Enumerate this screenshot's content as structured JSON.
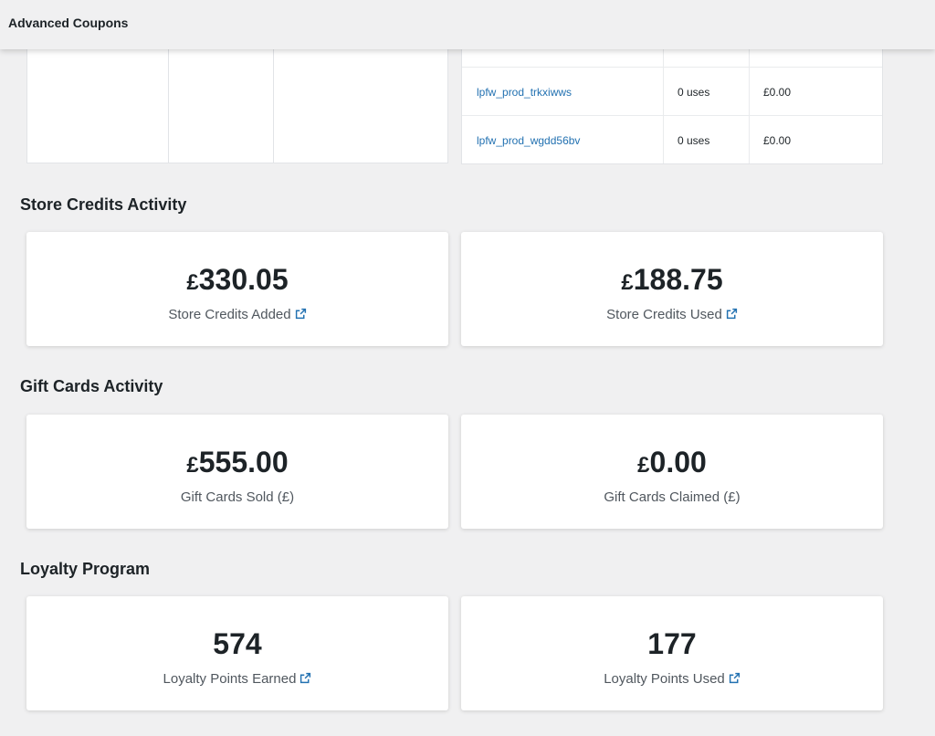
{
  "header": {
    "title": "Advanced Coupons"
  },
  "coupons_table": {
    "rows": [
      {
        "code": "lpfw_prod_trkxiwws",
        "uses": "0 uses",
        "amount": "£0.00"
      },
      {
        "code": "lpfw_prod_wgdd56bv",
        "uses": "0 uses",
        "amount": "£0.00"
      }
    ]
  },
  "store_credits": {
    "title": "Store Credits Activity",
    "added": {
      "currency": "£",
      "amount": "330.05",
      "label": "Store Credits Added"
    },
    "used": {
      "currency": "£",
      "amount": "188.75",
      "label": "Store Credits Used"
    }
  },
  "gift_cards": {
    "title": "Gift Cards Activity",
    "sold": {
      "currency": "£",
      "amount": "555.00",
      "label": "Gift Cards Sold (£)"
    },
    "claimed": {
      "currency": "£",
      "amount": "0.00",
      "label": "Gift Cards Claimed (£)"
    }
  },
  "loyalty": {
    "title": "Loyalty Program",
    "earned": {
      "value": "574",
      "label": "Loyalty Points Earned"
    },
    "used": {
      "value": "177",
      "label": "Loyalty Points Used"
    }
  },
  "icons": {
    "external_link": "external-link-icon"
  },
  "colors": {
    "link": "#2271b1",
    "background": "#f0f0f1"
  }
}
